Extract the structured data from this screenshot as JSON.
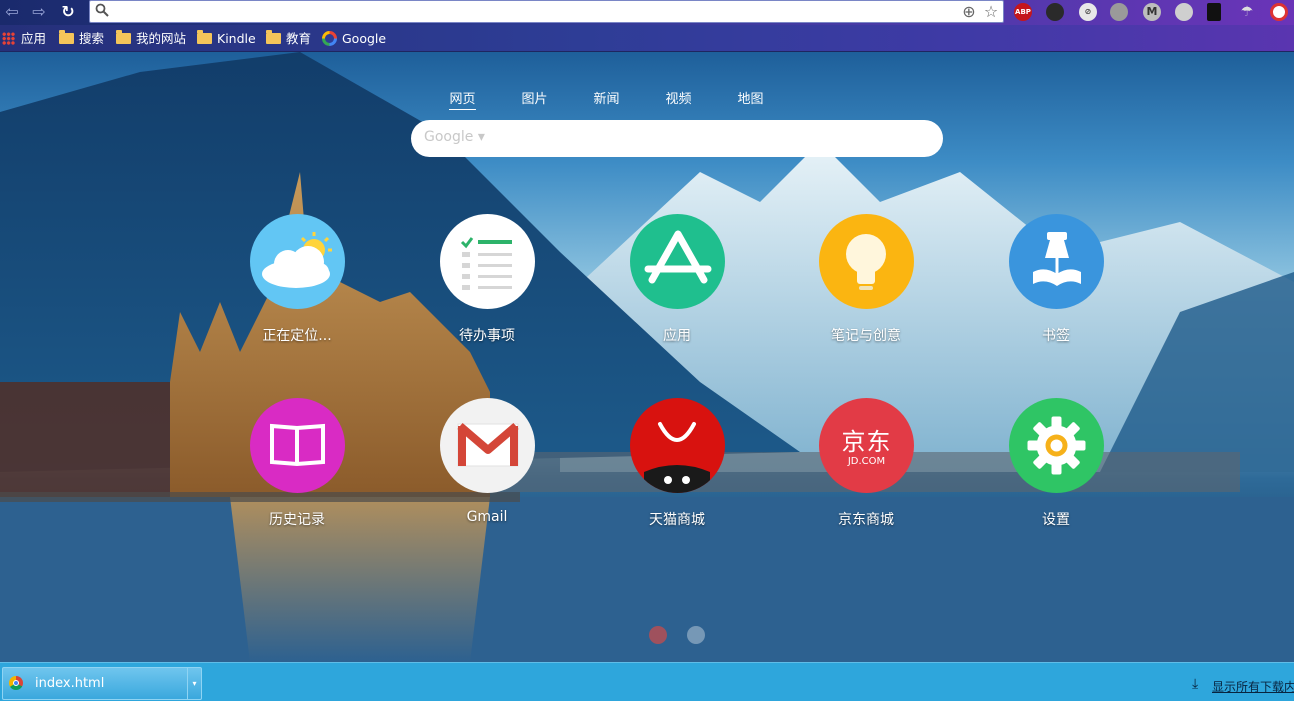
{
  "toolbar": {
    "back_icon": "back-arrow-icon",
    "forward_icon": "forward-arrow-icon",
    "reload_icon": "reload-icon",
    "address_value": "",
    "extensions": [
      "ABP",
      "M"
    ]
  },
  "bookmarks": {
    "items": [
      {
        "label": "应用",
        "icon": "apps-grid-icon"
      },
      {
        "label": "搜索",
        "icon": "folder-icon"
      },
      {
        "label": "我的网站",
        "icon": "folder-icon"
      },
      {
        "label": "Kindle",
        "icon": "folder-icon"
      },
      {
        "label": "教育",
        "icon": "folder-icon"
      },
      {
        "label": "Google",
        "icon": "google-icon"
      }
    ]
  },
  "search": {
    "tabs": [
      "网页",
      "图片",
      "新闻",
      "视频",
      "地图"
    ],
    "active_tab": "网页",
    "engine_label": "Google ▾",
    "value": ""
  },
  "tiles": [
    {
      "label": "正在定位...",
      "icon": "weather-icon",
      "color": "#62c6f4"
    },
    {
      "label": "待办事项",
      "icon": "todo-list-icon",
      "color": "#ffffff"
    },
    {
      "label": "应用",
      "icon": "app-store-icon",
      "color": "#1fbf8e"
    },
    {
      "label": "笔记与创意",
      "icon": "lightbulb-icon",
      "color": "#fbb511"
    },
    {
      "label": "书签",
      "icon": "bookmark-pin-icon",
      "color": "#3a95dd"
    },
    {
      "label": "历史记录",
      "icon": "history-book-icon",
      "color": "#d92bc4"
    },
    {
      "label": "Gmail",
      "icon": "gmail-icon",
      "color": "#f2f2f2"
    },
    {
      "label": "天猫商城",
      "icon": "tmall-icon",
      "color": "#d8120f"
    },
    {
      "label": "京东商城",
      "icon": "jd-icon",
      "color": "#e23b46",
      "logo_text": "京东",
      "logo_sub": "JD.COM"
    },
    {
      "label": "设置",
      "icon": "settings-gear-icon",
      "color": "#2fc565"
    }
  ],
  "pagination": {
    "total": 2,
    "current": 1
  },
  "download_bar": {
    "file_name": "index.html",
    "show_all_label": "显示所有下载内"
  }
}
